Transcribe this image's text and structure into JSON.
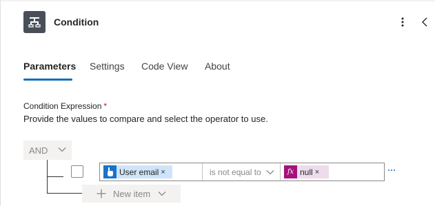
{
  "header": {
    "title": "Condition",
    "icon": "condition-icon"
  },
  "tabs": [
    {
      "label": "Parameters",
      "active": true
    },
    {
      "label": "Settings",
      "active": false
    },
    {
      "label": "Code View",
      "active": false
    },
    {
      "label": "About",
      "active": false
    }
  ],
  "condition": {
    "label": "Condition Expression",
    "required_mark": "*",
    "description": "Provide the values to compare and select the operator to use.",
    "group_operator": "AND",
    "row": {
      "left_token": "User email",
      "left_token_remove": "×",
      "operator": "is not equal to",
      "right_token": "null",
      "right_token_remove": "×",
      "right_token_icon_text": "fx"
    },
    "new_item_label": "New item"
  },
  "colors": {
    "accent": "#0f6cbd",
    "user_token_bg": "#cfe4fa",
    "fx_token_bg": "#eedcec",
    "fx_icon": "#a4127d",
    "required": "#c50f1f"
  }
}
